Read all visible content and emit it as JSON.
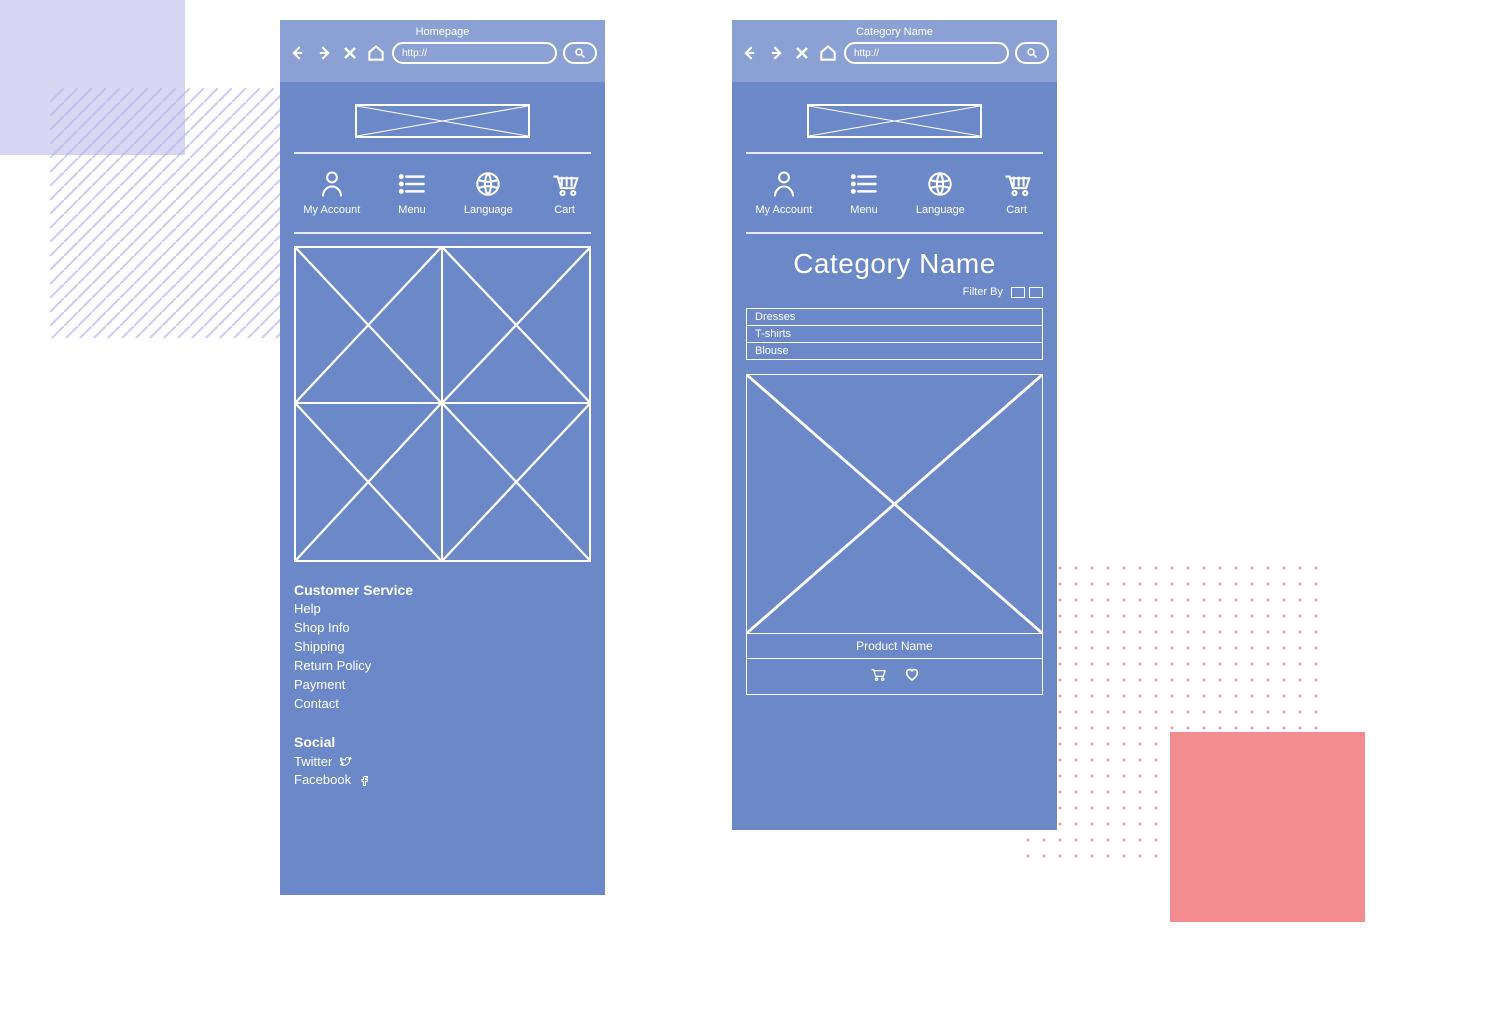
{
  "frames": {
    "homepage": {
      "title": "Homepage",
      "url": "http://",
      "nav": [
        {
          "label": "My Account"
        },
        {
          "label": "Menu"
        },
        {
          "label": "Language"
        },
        {
          "label": "Cart"
        }
      ],
      "footer": {
        "service_heading": "Customer Service",
        "service_links": [
          "Help",
          "Shop Info",
          "Shipping",
          "Return Policy",
          "Payment",
          "Contact"
        ],
        "social_heading": "Social",
        "social_links": [
          "Twitter",
          "Facebook"
        ]
      }
    },
    "category": {
      "title": "Category Name",
      "url": "http://",
      "nav": [
        {
          "label": "My Account"
        },
        {
          "label": "Menu"
        },
        {
          "label": "Language"
        },
        {
          "label": "Cart"
        }
      ],
      "heading": "Category Name",
      "filter_label": "Filter By",
      "filters": [
        "Dresses",
        "T-shirts",
        "Blouse"
      ],
      "product_name": "Product Name"
    }
  }
}
